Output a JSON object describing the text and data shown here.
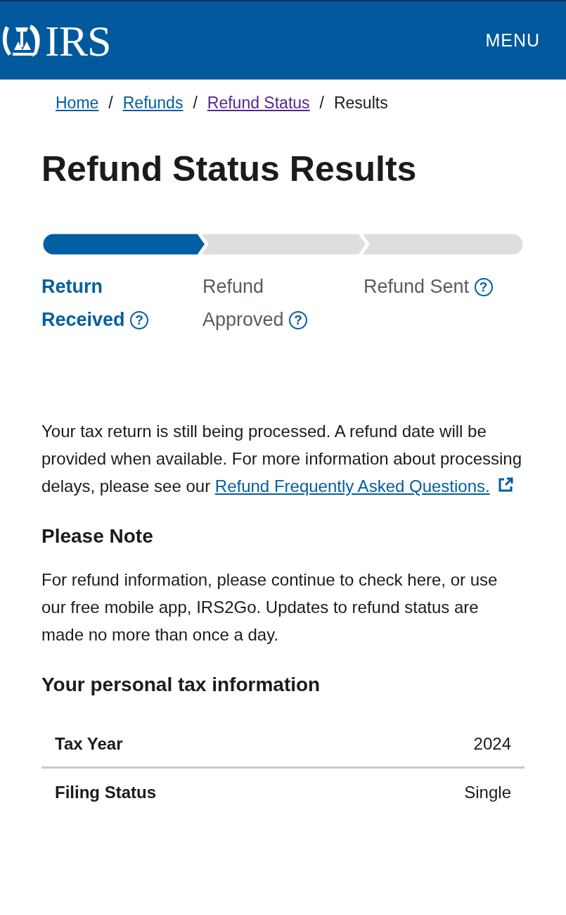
{
  "header": {
    "logo_text": "IRS",
    "menu": "MENU"
  },
  "breadcrumb": [
    {
      "label": "Home",
      "kind": "link"
    },
    {
      "label": "Refunds",
      "kind": "link"
    },
    {
      "label": "Refund Status",
      "kind": "visited"
    },
    {
      "label": "Results",
      "kind": "current"
    }
  ],
  "breadcrumb_separator": "/",
  "title": "Refund Status Results",
  "steps": [
    {
      "label": "Return Received",
      "selected": true
    },
    {
      "label": "Refund Approved",
      "selected": false
    },
    {
      "label": "Refund Sent",
      "selected": false
    }
  ],
  "help_glyph": "?",
  "message": {
    "text": "Your tax return is still being processed. A refund date will be provided when available. For more information about processing delays, please see our",
    "link": "Refund Frequently Asked Questions."
  },
  "note": {
    "heading": "Please Note",
    "text": "For refund information, please continue to check here, or use our free mobile app, IRS2Go. Updates to refund status are made no more than once a day."
  },
  "info": {
    "heading": "Your personal tax information",
    "rows": [
      {
        "label": "Tax Year",
        "value": "2024"
      },
      {
        "label": "Filing Status",
        "value": "Single"
      }
    ]
  }
}
